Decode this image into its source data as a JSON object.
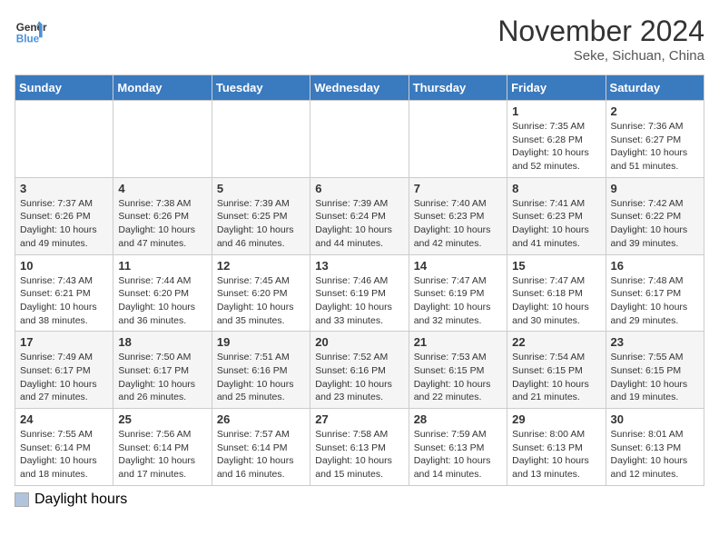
{
  "logo": {
    "line1": "General",
    "line2": "Blue"
  },
  "title": "November 2024",
  "location": "Seke, Sichuan, China",
  "days_of_week": [
    "Sunday",
    "Monday",
    "Tuesday",
    "Wednesday",
    "Thursday",
    "Friday",
    "Saturday"
  ],
  "weeks": [
    [
      {
        "day": "",
        "info": ""
      },
      {
        "day": "",
        "info": ""
      },
      {
        "day": "",
        "info": ""
      },
      {
        "day": "",
        "info": ""
      },
      {
        "day": "",
        "info": ""
      },
      {
        "day": "1",
        "info": "Sunrise: 7:35 AM\nSunset: 6:28 PM\nDaylight: 10 hours and 52 minutes."
      },
      {
        "day": "2",
        "info": "Sunrise: 7:36 AM\nSunset: 6:27 PM\nDaylight: 10 hours and 51 minutes."
      }
    ],
    [
      {
        "day": "3",
        "info": "Sunrise: 7:37 AM\nSunset: 6:26 PM\nDaylight: 10 hours and 49 minutes."
      },
      {
        "day": "4",
        "info": "Sunrise: 7:38 AM\nSunset: 6:26 PM\nDaylight: 10 hours and 47 minutes."
      },
      {
        "day": "5",
        "info": "Sunrise: 7:39 AM\nSunset: 6:25 PM\nDaylight: 10 hours and 46 minutes."
      },
      {
        "day": "6",
        "info": "Sunrise: 7:39 AM\nSunset: 6:24 PM\nDaylight: 10 hours and 44 minutes."
      },
      {
        "day": "7",
        "info": "Sunrise: 7:40 AM\nSunset: 6:23 PM\nDaylight: 10 hours and 42 minutes."
      },
      {
        "day": "8",
        "info": "Sunrise: 7:41 AM\nSunset: 6:23 PM\nDaylight: 10 hours and 41 minutes."
      },
      {
        "day": "9",
        "info": "Sunrise: 7:42 AM\nSunset: 6:22 PM\nDaylight: 10 hours and 39 minutes."
      }
    ],
    [
      {
        "day": "10",
        "info": "Sunrise: 7:43 AM\nSunset: 6:21 PM\nDaylight: 10 hours and 38 minutes."
      },
      {
        "day": "11",
        "info": "Sunrise: 7:44 AM\nSunset: 6:20 PM\nDaylight: 10 hours and 36 minutes."
      },
      {
        "day": "12",
        "info": "Sunrise: 7:45 AM\nSunset: 6:20 PM\nDaylight: 10 hours and 35 minutes."
      },
      {
        "day": "13",
        "info": "Sunrise: 7:46 AM\nSunset: 6:19 PM\nDaylight: 10 hours and 33 minutes."
      },
      {
        "day": "14",
        "info": "Sunrise: 7:47 AM\nSunset: 6:19 PM\nDaylight: 10 hours and 32 minutes."
      },
      {
        "day": "15",
        "info": "Sunrise: 7:47 AM\nSunset: 6:18 PM\nDaylight: 10 hours and 30 minutes."
      },
      {
        "day": "16",
        "info": "Sunrise: 7:48 AM\nSunset: 6:17 PM\nDaylight: 10 hours and 29 minutes."
      }
    ],
    [
      {
        "day": "17",
        "info": "Sunrise: 7:49 AM\nSunset: 6:17 PM\nDaylight: 10 hours and 27 minutes."
      },
      {
        "day": "18",
        "info": "Sunrise: 7:50 AM\nSunset: 6:17 PM\nDaylight: 10 hours and 26 minutes."
      },
      {
        "day": "19",
        "info": "Sunrise: 7:51 AM\nSunset: 6:16 PM\nDaylight: 10 hours and 25 minutes."
      },
      {
        "day": "20",
        "info": "Sunrise: 7:52 AM\nSunset: 6:16 PM\nDaylight: 10 hours and 23 minutes."
      },
      {
        "day": "21",
        "info": "Sunrise: 7:53 AM\nSunset: 6:15 PM\nDaylight: 10 hours and 22 minutes."
      },
      {
        "day": "22",
        "info": "Sunrise: 7:54 AM\nSunset: 6:15 PM\nDaylight: 10 hours and 21 minutes."
      },
      {
        "day": "23",
        "info": "Sunrise: 7:55 AM\nSunset: 6:15 PM\nDaylight: 10 hours and 19 minutes."
      }
    ],
    [
      {
        "day": "24",
        "info": "Sunrise: 7:55 AM\nSunset: 6:14 PM\nDaylight: 10 hours and 18 minutes."
      },
      {
        "day": "25",
        "info": "Sunrise: 7:56 AM\nSunset: 6:14 PM\nDaylight: 10 hours and 17 minutes."
      },
      {
        "day": "26",
        "info": "Sunrise: 7:57 AM\nSunset: 6:14 PM\nDaylight: 10 hours and 16 minutes."
      },
      {
        "day": "27",
        "info": "Sunrise: 7:58 AM\nSunset: 6:13 PM\nDaylight: 10 hours and 15 minutes."
      },
      {
        "day": "28",
        "info": "Sunrise: 7:59 AM\nSunset: 6:13 PM\nDaylight: 10 hours and 14 minutes."
      },
      {
        "day": "29",
        "info": "Sunrise: 8:00 AM\nSunset: 6:13 PM\nDaylight: 10 hours and 13 minutes."
      },
      {
        "day": "30",
        "info": "Sunrise: 8:01 AM\nSunset: 6:13 PM\nDaylight: 10 hours and 12 minutes."
      }
    ]
  ],
  "legend": {
    "daylight_label": "Daylight hours"
  }
}
